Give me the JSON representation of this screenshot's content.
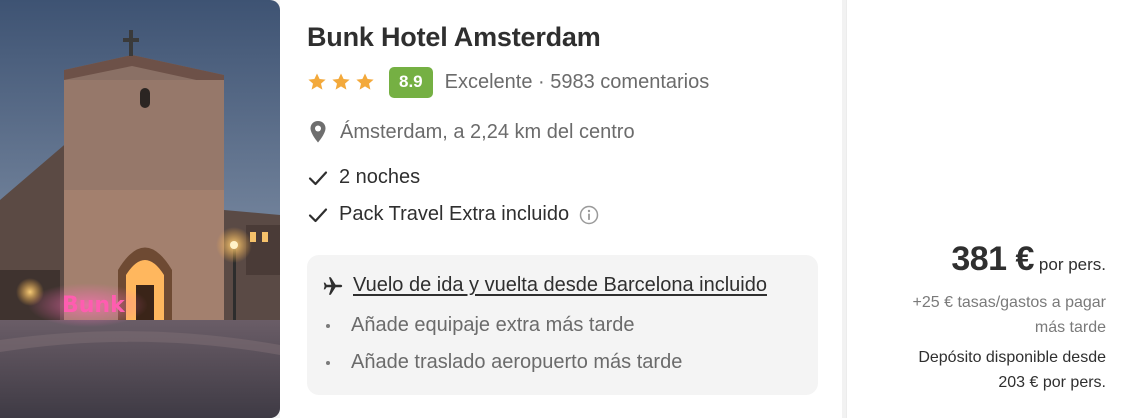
{
  "hotel": {
    "image_alt": "Bunk Hotel Amsterdam photo",
    "sign_text": "Bunk",
    "name": "Bunk Hotel Amsterdam",
    "stars": 3,
    "score": "8.9",
    "reviews_text": "Excelente · 5983 comentarios",
    "location": "Ámsterdam, a 2,24 km del centro"
  },
  "features": [
    {
      "label": "2 noches"
    },
    {
      "label": "Pack Travel Extra incluido"
    }
  ],
  "flight": {
    "main_label": "Vuelo de ida y vuelta desde Barcelona incluido",
    "extras": [
      {
        "label": "Añade equipaje extra más tarde"
      },
      {
        "label": "Añade traslado aeropuerto más tarde"
      }
    ]
  },
  "price": {
    "amount": "381 €",
    "unit": "por pers.",
    "taxes_line1": "+25 € tasas/gastos a pagar",
    "taxes_line2": "más tarde",
    "deposit_line1": "Depósito disponible desde",
    "deposit_line2": "203 € por pers."
  },
  "colors": {
    "star": "#f3a93b",
    "score_bg": "#75b043",
    "sign": "#ff4fa3"
  },
  "icons": [
    "star-icon",
    "location-pin-icon",
    "check-icon",
    "info-icon",
    "plane-icon"
  ]
}
